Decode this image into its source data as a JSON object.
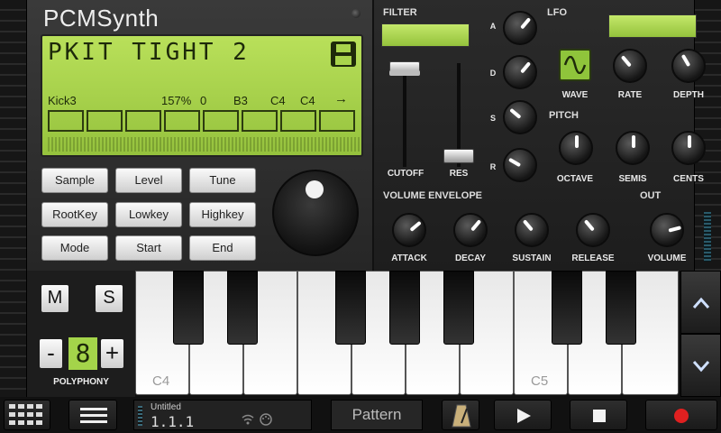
{
  "app_title": "PCMSynth",
  "lcd": {
    "preset_name": "PKIT TIGHT 2",
    "sample": "Kick3",
    "level": "157%",
    "tune": "0",
    "root": "B3",
    "low": "C4",
    "high": "C4",
    "arrow": "→"
  },
  "sample_buttons": [
    "Sample",
    "Level",
    "Tune",
    "RootKey",
    "Lowkey",
    "Highkey",
    "Mode",
    "Start",
    "End"
  ],
  "filter": {
    "label": "FILTER",
    "cutoff_label": "CUTOFF",
    "res_label": "RES",
    "adsr_labels": [
      "A",
      "D",
      "S",
      "R"
    ]
  },
  "lfo": {
    "label": "LFO",
    "wave_label": "WAVE",
    "rate_label": "RATE",
    "depth_label": "DEPTH"
  },
  "pitch": {
    "label": "PITCH",
    "octave_label": "OCTAVE",
    "semis_label": "SEMIS",
    "cents_label": "CENTS"
  },
  "volume_envelope": {
    "label": "VOLUME ENVELOPE",
    "attack_label": "ATTACK",
    "decay_label": "DECAY",
    "sustain_label": "SUSTAIN",
    "release_label": "RELEASE"
  },
  "out": {
    "label": "OUT",
    "volume_label": "VOLUME"
  },
  "keyboard": {
    "mute_label": "M",
    "solo_label": "S",
    "minus_label": "-",
    "plus_label": "+",
    "polyphony_value": "8",
    "polyphony_label": "POLYPHONY",
    "c4_label": "C4",
    "c5_label": "C5"
  },
  "transport": {
    "song_name": "Untitled",
    "position": "1.1.1",
    "pattern_label": "Pattern"
  },
  "colors": {
    "lcd_green": "#a9d44c",
    "record_red": "#e02020"
  }
}
